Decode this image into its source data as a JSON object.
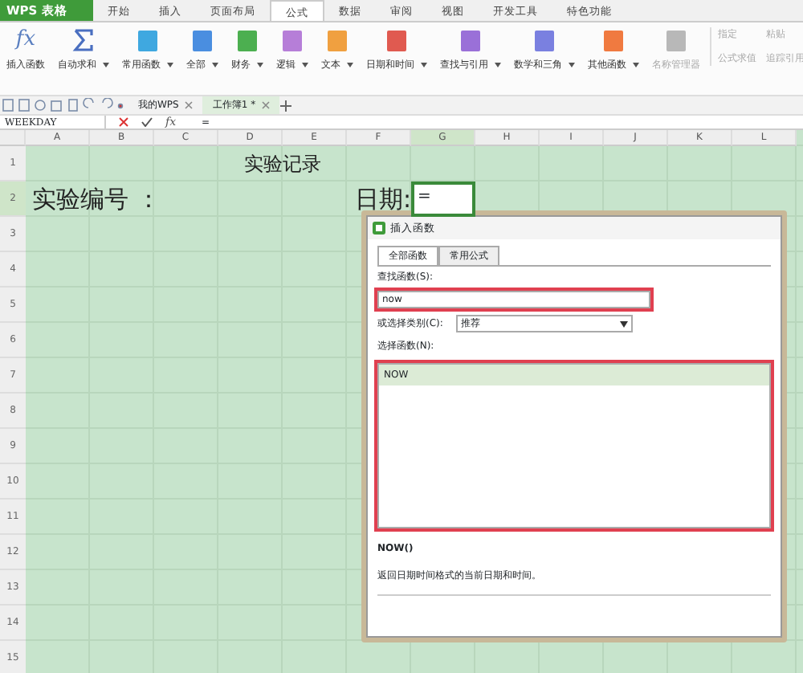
{
  "app": {
    "title": "WPS 表格"
  },
  "menu_tabs": [
    {
      "label": "开始",
      "selected": false
    },
    {
      "label": "插入",
      "selected": false
    },
    {
      "label": "页面布局",
      "selected": false
    },
    {
      "label": "公式",
      "selected": true
    },
    {
      "label": "数据",
      "selected": false
    },
    {
      "label": "审阅",
      "selected": false
    },
    {
      "label": "视图",
      "selected": false
    },
    {
      "label": "开发工具",
      "selected": false
    },
    {
      "label": "特色功能",
      "selected": false
    }
  ],
  "ribbon": [
    {
      "label": "插入函数",
      "kind": "fx",
      "icon_text": "fx",
      "has_menu": false,
      "disabled": false
    },
    {
      "label": "自动求和",
      "kind": "sigma",
      "has_menu": true,
      "disabled": false
    },
    {
      "label": "常用函数",
      "kind": "tile",
      "color": "#3fa8e0",
      "has_menu": true,
      "disabled": false
    },
    {
      "label": "全部",
      "kind": "tile",
      "color": "#4a8ee0",
      "has_menu": true,
      "disabled": false
    },
    {
      "label": "财务",
      "kind": "tile",
      "color": "#4caf50",
      "has_menu": true,
      "disabled": false
    },
    {
      "label": "逻辑",
      "kind": "tile",
      "color": "#b67ed8",
      "has_menu": true,
      "disabled": false
    },
    {
      "label": "文本",
      "kind": "tile",
      "color": "#f0a040",
      "has_menu": true,
      "disabled": false
    },
    {
      "label": "日期和时间",
      "kind": "tile",
      "color": "#e05a50",
      "has_menu": true,
      "disabled": false
    },
    {
      "label": "查找与引用",
      "kind": "tile",
      "color": "#9a70d8",
      "has_menu": true,
      "disabled": false
    },
    {
      "label": "数学和三角",
      "kind": "tile",
      "color": "#7a80e0",
      "has_menu": true,
      "disabled": false
    },
    {
      "label": "其他函数",
      "kind": "tile",
      "color": "#f07a40",
      "has_menu": true,
      "disabled": false
    },
    {
      "label": "名称管理器",
      "kind": "tile",
      "color": "#b8b8b8",
      "has_menu": false,
      "disabled": true
    },
    {
      "label": "指定",
      "kind": "small",
      "has_menu": false,
      "disabled": true
    },
    {
      "label": "粘贴",
      "kind": "small",
      "has_menu": false,
      "disabled": true
    },
    {
      "label": "公式求值",
      "kind": "small",
      "has_menu": false,
      "disabled": true
    },
    {
      "label": "追踪引用",
      "kind": "small",
      "has_menu": false,
      "disabled": true
    }
  ],
  "doc_tabs": [
    {
      "label": "我的WPS",
      "selected": false
    },
    {
      "label": "工作簿1 *",
      "selected": true
    }
  ],
  "formula_bar": {
    "name_box": "WEEKDAY",
    "fx": "fx",
    "value": "="
  },
  "columns": [
    {
      "label": "A",
      "selected": false
    },
    {
      "label": "B",
      "selected": false
    },
    {
      "label": "C",
      "selected": false
    },
    {
      "label": "D",
      "selected": false
    },
    {
      "label": "E",
      "selected": false
    },
    {
      "label": "F",
      "selected": false
    },
    {
      "label": "G",
      "selected": true
    },
    {
      "label": "H",
      "selected": false
    },
    {
      "label": "I",
      "selected": false
    },
    {
      "label": "J",
      "selected": false
    },
    {
      "label": "K",
      "selected": false
    },
    {
      "label": "L",
      "selected": false
    }
  ],
  "rows": [
    {
      "label": "1",
      "selected": false,
      "cells": [
        {
          "kind": "title",
          "text": "实验记录"
        }
      ]
    },
    {
      "label": "2",
      "selected": true,
      "cells": [
        {
          "kind": "left",
          "text": "实验编号 ："
        },
        {
          "kind": "right",
          "text": "日期:"
        },
        {
          "kind": "active",
          "text": "="
        }
      ]
    },
    {
      "label": "3",
      "selected": false
    },
    {
      "label": "4",
      "selected": false
    },
    {
      "label": "5",
      "selected": false
    },
    {
      "label": "6",
      "selected": false
    },
    {
      "label": "7",
      "selected": false
    },
    {
      "label": "8",
      "selected": false
    },
    {
      "label": "9",
      "selected": false
    },
    {
      "label": "10",
      "selected": false
    },
    {
      "label": "11",
      "selected": false
    },
    {
      "label": "12",
      "selected": false
    },
    {
      "label": "13",
      "selected": false
    },
    {
      "label": "14",
      "selected": false
    },
    {
      "label": "15",
      "selected": false
    }
  ],
  "dialog": {
    "title": "插入函数",
    "tabs": [
      {
        "label": "全部函数",
        "selected": true
      },
      {
        "label": "常用公式",
        "selected": false
      }
    ],
    "search": {
      "label": "查找函数(S):",
      "value": "now",
      "highlighted": true
    },
    "category": {
      "label": "或选择类别(C):",
      "value": "推荐"
    },
    "list": {
      "label": "选择函数(N):",
      "highlighted": true,
      "items": [
        {
          "name": "NOW",
          "selected": true
        }
      ]
    },
    "signature": "NOW()",
    "description": "返回日期时间格式的当前日期和时间。"
  }
}
